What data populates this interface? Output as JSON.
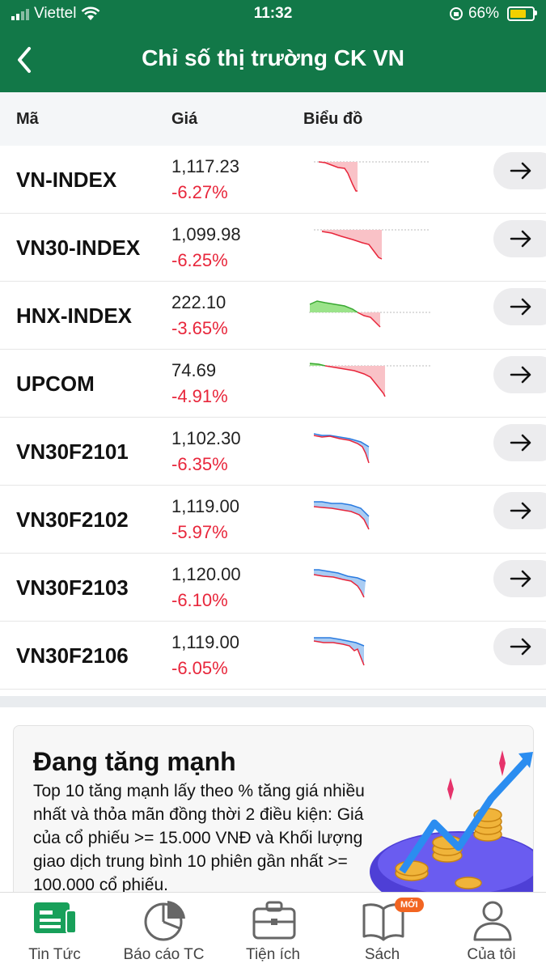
{
  "status_bar": {
    "carrier": "Viettel",
    "time": "11:32",
    "battery": "66%",
    "battery_level": 0.66
  },
  "header": {
    "title": "Chỉ số thị trường CK VN"
  },
  "table": {
    "columns": [
      "Mã",
      "Giá",
      "Biểu đồ"
    ],
    "rows": [
      {
        "code": "VN-INDEX",
        "price": "1,117.23",
        "change": "-6.27%"
      },
      {
        "code": "VN30-INDEX",
        "price": "1,099.98",
        "change": "-6.25%"
      },
      {
        "code": "HNX-INDEX",
        "price": "222.10",
        "change": "-3.65%"
      },
      {
        "code": "UPCOM",
        "price": "74.69",
        "change": "-4.91%"
      },
      {
        "code": "VN30F2101",
        "price": "1,102.30",
        "change": "-6.35%"
      },
      {
        "code": "VN30F2102",
        "price": "1,119.00",
        "change": "-5.97%"
      },
      {
        "code": "VN30F2103",
        "price": "1,120.00",
        "change": "-6.10%"
      },
      {
        "code": "VN30F2106",
        "price": "1,119.00",
        "change": "-6.05%"
      }
    ]
  },
  "feature_card": {
    "title": "Đang tăng mạnh",
    "description": "Top 10 tăng mạnh lấy theo % tăng giá nhiều nhất và thỏa mãn đồng thời 2 điều kiện: Giá của cổ phiếu >= 15.000 VNĐ và Khối lượng giao dịch trung bình 10 phiên gần nhất >= 100.000 cổ phiếu."
  },
  "tabs": [
    {
      "label": "Tin Tức",
      "icon": "news-icon",
      "active": true
    },
    {
      "label": "Báo cáo TC",
      "icon": "pie-chart-icon"
    },
    {
      "label": "Tiện ích",
      "icon": "briefcase-icon"
    },
    {
      "label": "Sách",
      "icon": "book-icon",
      "badge": "MỚI"
    },
    {
      "label": "Của tôi",
      "icon": "user-icon"
    }
  ],
  "colors": {
    "brand": "#127848",
    "negative": "#e8263b",
    "positive_fill": "#8ee07a",
    "future_fill": "#a9ccf3",
    "badge": "#f26522"
  }
}
